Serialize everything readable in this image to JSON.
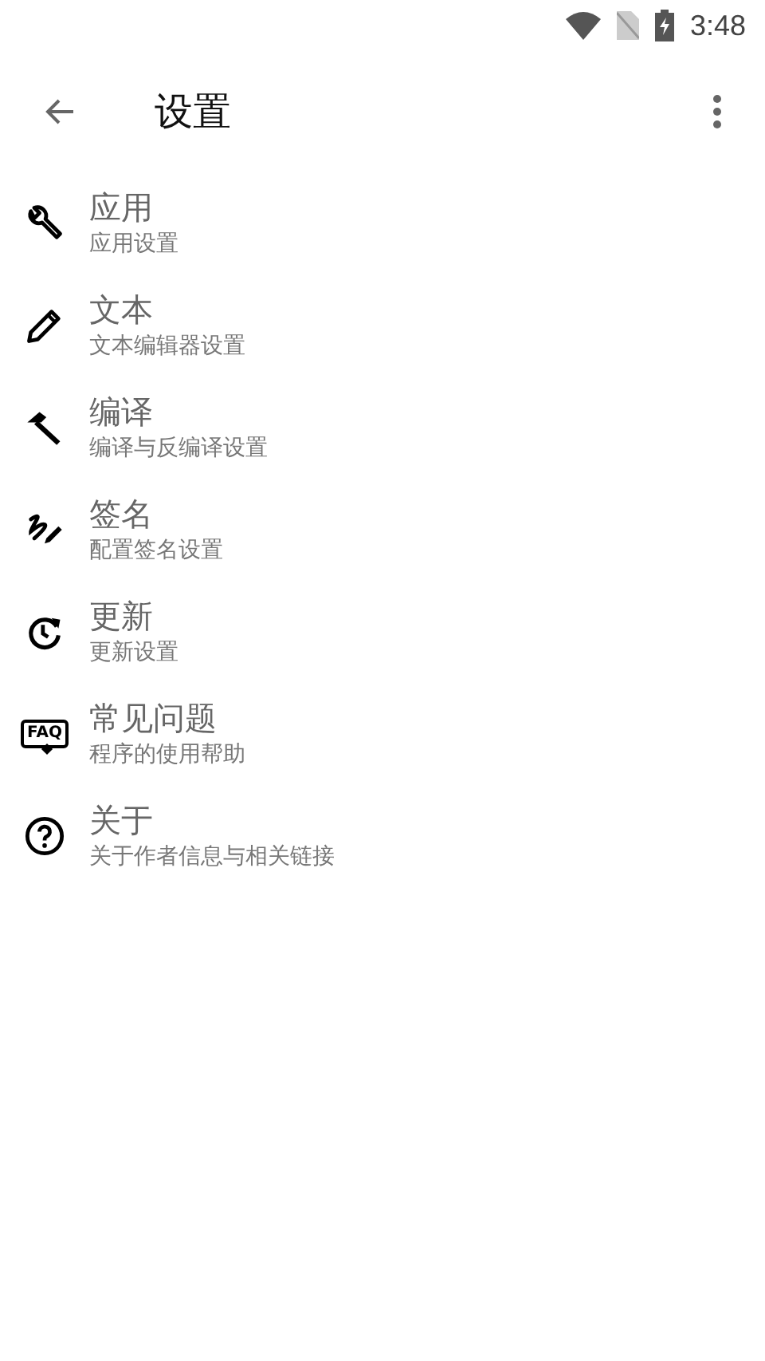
{
  "status_bar": {
    "time": "3:48"
  },
  "toolbar": {
    "title": "设置"
  },
  "items": [
    {
      "title": "应用",
      "subtitle": "应用设置"
    },
    {
      "title": "文本",
      "subtitle": "文本编辑器设置"
    },
    {
      "title": "编译",
      "subtitle": "编译与反编译设置"
    },
    {
      "title": "签名",
      "subtitle": "配置签名设置"
    },
    {
      "title": "更新",
      "subtitle": "更新设置"
    },
    {
      "icon_text": "FAQ",
      "title": "常见问题",
      "subtitle": "程序的使用帮助"
    },
    {
      "title": "关于",
      "subtitle": "关于作者信息与相关链接"
    }
  ]
}
